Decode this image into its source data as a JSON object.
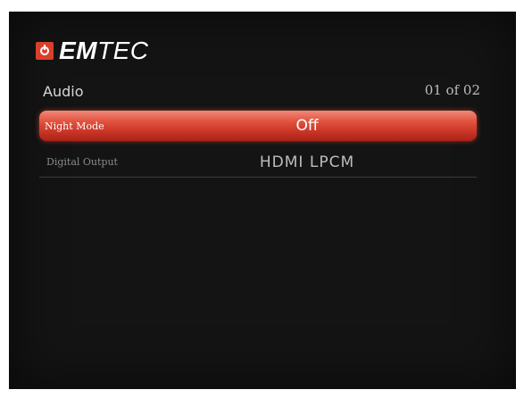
{
  "brand": {
    "logo_bold": "EM",
    "logo_light": "TEC",
    "accent": "#d8402d"
  },
  "header": {
    "section_title": "Audio",
    "page_indicator": "01 of 02"
  },
  "settings": [
    {
      "label": "Night Mode",
      "value": "Off",
      "selected": true
    },
    {
      "label": "Digital Output",
      "value": "HDMI LPCM",
      "selected": false
    }
  ],
  "colors": {
    "background": "#141414",
    "highlight": "#e2533f",
    "text": "#ffffff",
    "muted": "#8a8a8a"
  }
}
